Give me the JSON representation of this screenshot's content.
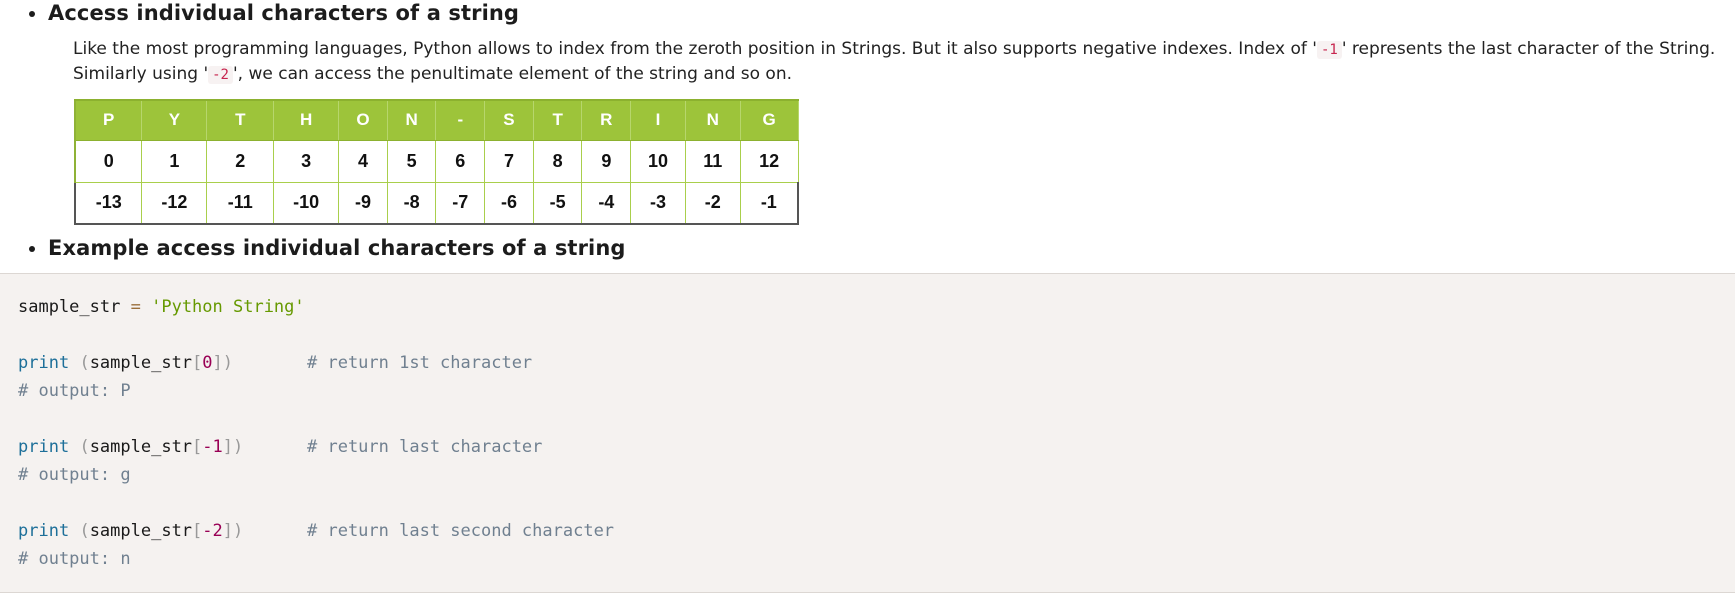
{
  "section1": {
    "heading": "Access individual characters of a string",
    "para_line1_before": "Like the most programming languages, Python allows to index from the zeroth position in Strings. But it also supports negative indexes. Index of '",
    "para_code1": "-1",
    "para_line1_after": "' represents the last character of the String.",
    "para_line2_before": "Similarly using '",
    "para_code2": "-2",
    "para_line2_after": "', we can access the penultimate element of the string and so on."
  },
  "index_table": {
    "letters": [
      "P",
      "Y",
      "T",
      "H",
      "O",
      "N",
      "-",
      "S",
      "T",
      "R",
      "I",
      "N",
      "G"
    ],
    "positive": [
      "0",
      "1",
      "2",
      "3",
      "4",
      "5",
      "6",
      "7",
      "8",
      "9",
      "10",
      "11",
      "12"
    ],
    "negative": [
      "-13",
      "-12",
      "-11",
      "-10",
      "-9",
      "-8",
      "-7",
      "-6",
      "-5",
      "-4",
      "-3",
      "-2",
      "-1"
    ]
  },
  "section2": {
    "heading": "Example access individual characters of a string"
  },
  "code": {
    "line1": {
      "var": "sample_str",
      "op": "=",
      "str": "'Python String'"
    },
    "line2": {
      "fn": "print",
      "arg": "sample_str",
      "index": "0",
      "comment": "# return 1st character"
    },
    "line3": {
      "comment": "# output: P"
    },
    "line4": {
      "fn": "print",
      "arg": "sample_str",
      "index": "-1",
      "comment": "# return last character"
    },
    "line5": {
      "comment": "# output: g"
    },
    "line6": {
      "fn": "print",
      "arg": "sample_str",
      "index": "-2",
      "comment": "# return last second character"
    },
    "line7": {
      "comment": "# output: n"
    }
  },
  "colors": {
    "table_header_bg": "#9dc43a",
    "code_bg": "#f5f2f0",
    "inline_code_color": "#c7254e",
    "code_fn": "#1d6f99",
    "code_string": "#669900",
    "code_number": "#990055",
    "code_comment": "#708090"
  }
}
